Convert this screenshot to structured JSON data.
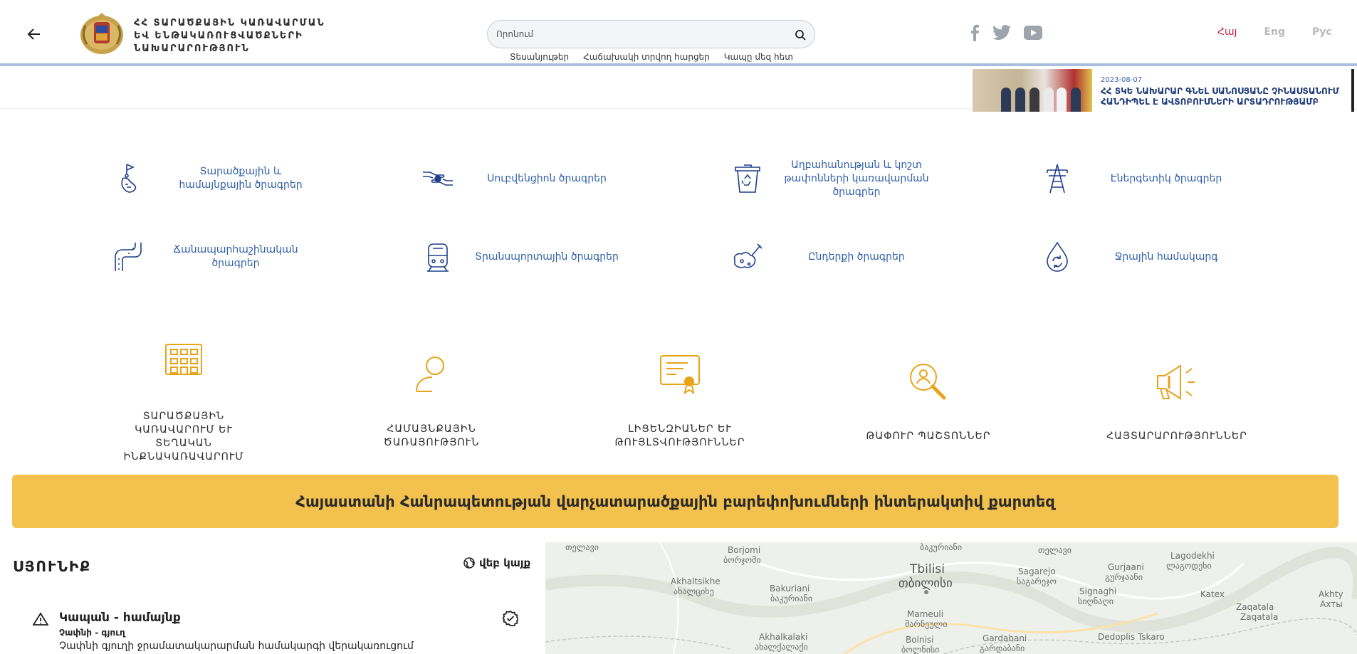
{
  "header": {
    "ministry_name": "ՀՀ ՏԱՐԱԾՔԱՅԻՆ ԿԱՌԱՎԱՐՄԱՆ ԵՎ ԵՆԹԱԿԱՌՈՒՑՎԱԾՔՆԵՐԻ ՆԱԽԱՐԱՐՈՒԹՅՈՒՆ",
    "search_placeholder": "Որոնում",
    "links": [
      "Տեսանյութեր",
      "Հաճախակի տրվող հարցեր",
      "Կապը մեզ հետ"
    ],
    "socials": [
      "facebook-icon",
      "twitter-icon",
      "youtube-icon"
    ],
    "languages": [
      "Հայ",
      "Eng",
      "Рус"
    ],
    "active_language": "Հայ"
  },
  "news": {
    "date": "2023-08-07",
    "title": "ՀՀ ՏԿԵ ՆԱԽԱՐԱՐ ԳՆԵԼ ՍԱՆՈՍՅԱՆԸ ՉԻՆԱՍՏԱՆՈՒՄ ՀԱՆԴԻՊԵԼ Է ԱՎՏՈԲՈՒՍՆԵՐԻ ԱՐՏԱԴՐՈՒԹՅԱՄԲ"
  },
  "programs": [
    {
      "label": "Տարածքային և համայնքային ծրագրեր",
      "icon": "map-flag-icon"
    },
    {
      "label": "Սուբվենցիոն ծրագրեր",
      "icon": "hands-icon"
    },
    {
      "label": "Աղբահանության և կոշտ թափոնների կառավարման ծրագրեր",
      "icon": "recycle-bin-icon"
    },
    {
      "label": "Էներգետիկ ծրագրեր",
      "icon": "power-tower-icon"
    },
    {
      "label": "Ճանապարհաշինական ծրագրեր",
      "icon": "road-icon"
    },
    {
      "label": "Տրանսպորտային ծրագրեր",
      "icon": "train-icon"
    },
    {
      "label": "Ընդերքի ծրագրեր",
      "icon": "mining-icon"
    },
    {
      "label": "Ջրային համակարգ",
      "icon": "water-drop-icon"
    }
  ],
  "services": [
    {
      "label": "ՏԱՐԱԾՔԱՅԻՆ ԿԱՌԱՎԱՐՈՒՄ ԵՒ ՏԵՂԱԿԱՆ ԻՆՔՆԱԿԱՌԱՎԱՐՈՒՄ",
      "icon": "building-icon"
    },
    {
      "label": "ՀԱՄԱՅՆՔԱՅԻՆ ԾԱՌԱՅՈՒԹՅՈՒՆ",
      "icon": "person-icon"
    },
    {
      "label": "ԼԻՑԵՆԶԻԱՆԵՐ ԵՒ ԹՈՒՅԼՏՎՈՒԹՅՈՒՆՆԵՐ",
      "icon": "certificate-icon"
    },
    {
      "label": "ԹԱՓՈՒՐ ՊԱՇՏՈՆՆԵՐ",
      "icon": "search-person-icon"
    },
    {
      "label": "ՀԱՅՏԱՐԱՐՈՒԹՅՈՒՆՆԵՐ",
      "icon": "megaphone-icon"
    }
  ],
  "banner": {
    "text": "Հայաստանի Հանրապետության վարչատարածքային բարեփոխումների ինտերակտիվ քարտեզ"
  },
  "region": {
    "title": "ՍՅՈՒՆԻՔ",
    "back_link": "վեբ կայք",
    "project": {
      "title": "Կապան - համայնք",
      "subtitle": "Չափնի - գյուղ",
      "description": "Չափնի գյուղի ջրամատակարարման համակարգի վերակառուցում"
    }
  },
  "map": {
    "labels": [
      {
        "text": "Tbilisi",
        "kind": "city"
      },
      {
        "text": "თბილისი",
        "kind": "city"
      },
      {
        "text": "Borjomi",
        "kind": "town"
      },
      {
        "text": "ბორჯომი",
        "kind": "town"
      },
      {
        "text": "Akhaltsikhe",
        "kind": "town"
      },
      {
        "text": "ახალციხე",
        "kind": "town"
      },
      {
        "text": "Bakuriani",
        "kind": "town"
      },
      {
        "text": "ბაკურიანი",
        "kind": "town"
      },
      {
        "text": "Sagarejo",
        "kind": "town"
      },
      {
        "text": "საგარეჯო",
        "kind": "town"
      },
      {
        "text": "Gurjaani",
        "kind": "town"
      },
      {
        "text": "გურჯაანი",
        "kind": "town"
      },
      {
        "text": "Lagodekhi",
        "kind": "town"
      },
      {
        "text": "ლაგოდეხი",
        "kind": "town"
      },
      {
        "text": "Signaghi",
        "kind": "town"
      },
      {
        "text": "სიღნაღი",
        "kind": "town"
      },
      {
        "text": "Mameuli",
        "kind": "town"
      },
      {
        "text": "მარნეული",
        "kind": "town"
      },
      {
        "text": "Gardabani",
        "kind": "town"
      },
      {
        "text": "გარდაბანი",
        "kind": "town"
      },
      {
        "text": "Akhalkalaki",
        "kind": "town"
      },
      {
        "text": "ახალქალაქი",
        "kind": "town"
      },
      {
        "text": "Bolnisi",
        "kind": "town"
      },
      {
        "text": "ბოლნისი",
        "kind": "town"
      },
      {
        "text": "Dedoplis Tskaro",
        "kind": "town"
      },
      {
        "text": "Katex",
        "kind": "town"
      },
      {
        "text": "Zaqatala",
        "kind": "town"
      },
      {
        "text": "Zaqatala",
        "kind": "town"
      },
      {
        "text": "Akhty",
        "kind": "town"
      },
      {
        "text": "Ахты",
        "kind": "town"
      },
      {
        "text": "ბაკურიანი",
        "kind": "town"
      },
      {
        "text": "თელავი",
        "kind": "town"
      }
    ]
  }
}
